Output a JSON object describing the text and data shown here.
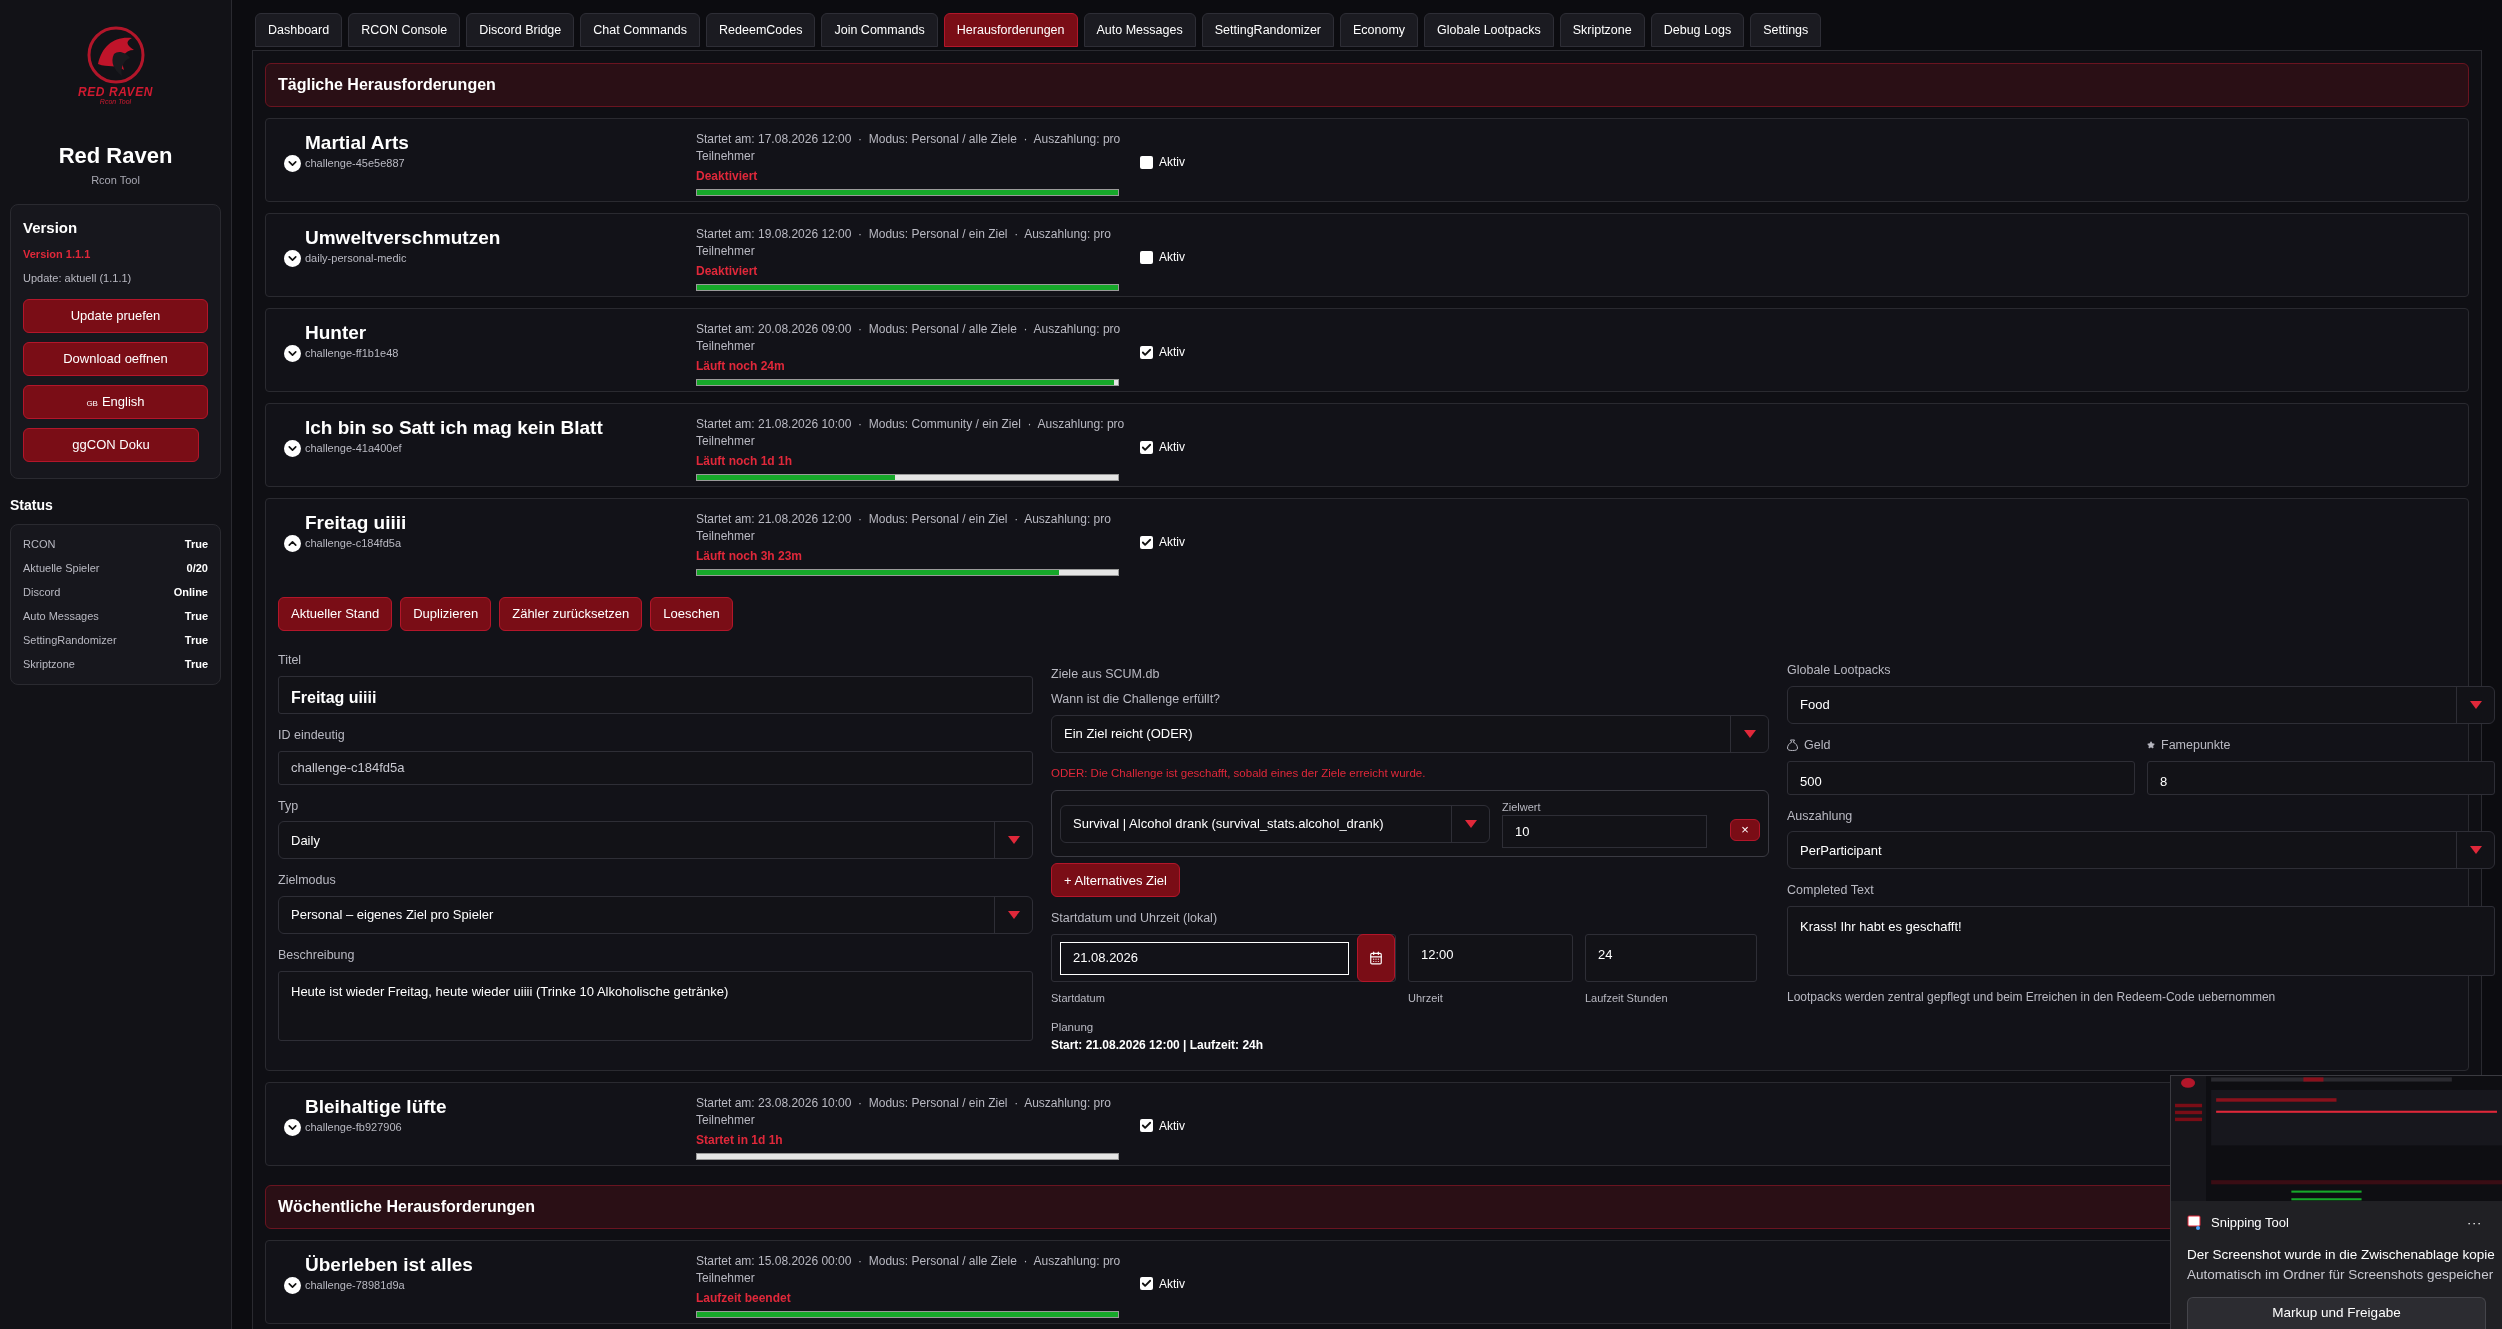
{
  "sidebar": {
    "logo": {
      "name": "RED RAVEN",
      "tagline": "Rcon Tool"
    },
    "title": "Red Raven",
    "subtitle": "Rcon Tool",
    "version_card": {
      "heading": "Version",
      "version": "Version 1.1.1",
      "update": "Update: aktuell (1.1.1)",
      "buttons": [
        {
          "label": "Update pruefen"
        },
        {
          "label": "Download oeffnen"
        },
        {
          "flag": "GB",
          "label": "English"
        },
        {
          "label": "ggCON Doku"
        }
      ]
    },
    "status": {
      "heading": "Status",
      "rows": [
        {
          "label": "RCON",
          "value": "True"
        },
        {
          "label": "Aktuelle Spieler",
          "value": "0/20"
        },
        {
          "label": "Discord",
          "value": "Online"
        },
        {
          "label": "Auto Messages",
          "value": "True"
        },
        {
          "label": "SettingRandomizer",
          "value": "True"
        },
        {
          "label": "Skriptzone",
          "value": "True"
        }
      ]
    }
  },
  "tabs": [
    {
      "label": "Dashboard",
      "selected": false
    },
    {
      "label": "RCON Console",
      "selected": false
    },
    {
      "label": "Discord Bridge",
      "selected": false
    },
    {
      "label": "Chat Commands",
      "selected": false
    },
    {
      "label": "RedeemCodes",
      "selected": false
    },
    {
      "label": "Join Commands",
      "selected": false
    },
    {
      "label": "Herausforderungen",
      "selected": true
    },
    {
      "label": "Auto Messages",
      "selected": false
    },
    {
      "label": "SettingRandomizer",
      "selected": false
    },
    {
      "label": "Economy",
      "selected": false
    },
    {
      "label": "Globale Lootpacks",
      "selected": false
    },
    {
      "label": "Skriptzone",
      "selected": false
    },
    {
      "label": "Debug Logs",
      "selected": false
    },
    {
      "label": "Settings",
      "selected": false
    }
  ],
  "sections": [
    {
      "title": "Tägliche Herausforderungen",
      "challenges": [
        {
          "title": "Martial Arts",
          "id": "challenge-45e5e887",
          "meta": "Startet am: 17.08.2026 12:00  ·  Modus: Personal / alle Ziele  ·  Auszahlung: pro Teilnehmer",
          "status": "Deaktiviert",
          "level": 1,
          "active": false,
          "active_label": "Aktiv",
          "expanded": false
        },
        {
          "title": "Umweltverschmutzen",
          "id": "daily-personal-medic",
          "meta": "Startet am: 19.08.2026 12:00  ·  Modus: Personal / ein Ziel  ·  Auszahlung: pro Teilnehmer",
          "status": "Deaktiviert",
          "level": 1,
          "active": false,
          "active_label": "Aktiv",
          "expanded": false
        },
        {
          "title": "Hunter",
          "id": "challenge-ff1b1e48",
          "meta": "Startet am: 20.08.2026 09:00  ·  Modus: Personal / alle Ziele  ·  Auszahlung: pro Teilnehmer",
          "status": "Läuft noch 24m",
          "level": 0.99,
          "active": true,
          "active_label": "Aktiv",
          "expanded": false
        },
        {
          "title": "Ich bin so Satt ich mag kein Blatt",
          "id": "challenge-41a400ef",
          "meta": "Startet am: 21.08.2026 10:00  ·  Modus: Community / ein Ziel  ·  Auszahlung: pro Teilnehmer",
          "status": "Läuft noch 1d 1h",
          "level": 0.47,
          "active": true,
          "active_label": "Aktiv",
          "expanded": false
        },
        {
          "title": "Freitag uiiii",
          "id": "challenge-c184fd5a",
          "meta": "Startet am: 21.08.2026 12:00  ·  Modus: Personal / ein Ziel  ·  Auszahlung: pro Teilnehmer",
          "status": "Läuft noch 3h 23m",
          "level": 0.86,
          "active": true,
          "active_label": "Aktiv",
          "expanded": true,
          "editor": {
            "actions": [
              "Aktueller Stand",
              "Duplizieren",
              "Zähler zurücksetzen",
              "Loeschen"
            ],
            "left_fields": [
              {
                "kind": "title",
                "label": "Titel",
                "value": "Freitag uiiii"
              },
              {
                "kind": "text",
                "label": "ID eindeutig",
                "value": "challenge-c184fd5a"
              },
              {
                "kind": "select",
                "label": "Typ",
                "value": "Daily"
              },
              {
                "kind": "select",
                "label": "Zielmodus",
                "value": "Personal – eigenes Ziel pro Spieler"
              },
              {
                "kind": "textarea",
                "label": "Beschreibung",
                "value": "Heute ist wieder Freitag, heute wieder uiiii (Trinke 10 Alkoholische getränke)"
              }
            ],
            "goals": {
              "heading": "Ziele aus SCUM.db",
              "condition_label": "Wann ist die Challenge erfüllt?",
              "condition": "Ein Ziel reicht (ODER)",
              "hint": "ODER: Die Challenge ist geschafft, sobald eines der Ziele erreicht wurde.",
              "items": [
                {
                  "objective": "Survival | Alcohol drank (survival_stats.alcohol_drank)",
                  "target_label": "Zielwert",
                  "target": "10",
                  "remove": "×"
                }
              ],
              "add_button": "+ Alternatives Ziel"
            },
            "schedule": {
              "label": "Startdatum und Uhrzeit (lokal)",
              "date": "21.08.2026",
              "date_caption": "Startdatum",
              "time": "12:00",
              "time_caption": "Uhrzeit",
              "duration": "24",
              "duration_caption": "Laufzeit Stunden",
              "planning_label": "Planung",
              "planning": "Start: 21.08.2026 12:00 | Laufzeit: 24h"
            },
            "rewards": {
              "lootpacks_label": "Globale Lootpacks",
              "lootpacks": "Food",
              "money_label": "Geld",
              "money": "500",
              "fame_label": "Famepunkte",
              "fame": "8",
              "payout_label": "Auszahlung",
              "payout": "PerParticipant",
              "completed_label": "Completed Text",
              "completed": "Krass! Ihr habt es geschafft!",
              "note": "Lootpacks werden zentral gepflegt und beim Erreichen in den Redeem-Code uebernommen"
            }
          }
        },
        {
          "title": "Bleihaltige lüfte",
          "id": "challenge-fb927906",
          "meta": "Startet am: 23.08.2026 10:00  ·  Modus: Personal / ein Ziel  ·  Auszahlung: pro Teilnehmer",
          "status": "Startet in 1d 1h",
          "level": 0,
          "active": true,
          "active_label": "Aktiv",
          "expanded": false
        }
      ]
    },
    {
      "title": "Wöchentliche Herausforderungen",
      "challenges": [
        {
          "title": "Überleben ist alles",
          "id": "challenge-78981d9a",
          "meta": "Startet am: 15.08.2026 00:00  ·  Modus: Personal / alle Ziele  ·  Auszahlung: pro Teilnehmer",
          "status": "Laufzeit beendet",
          "level": 1,
          "active": true,
          "active_label": "Aktiv",
          "expanded": false
        }
      ]
    }
  ],
  "notification": {
    "app": "Snipping Tool",
    "more": "···",
    "title": "Der Screenshot wurde in die Zwischenablage kopie",
    "body": "Automatisch im Ordner für Screenshots gespeicher",
    "button": "Markup und Freigabe"
  }
}
